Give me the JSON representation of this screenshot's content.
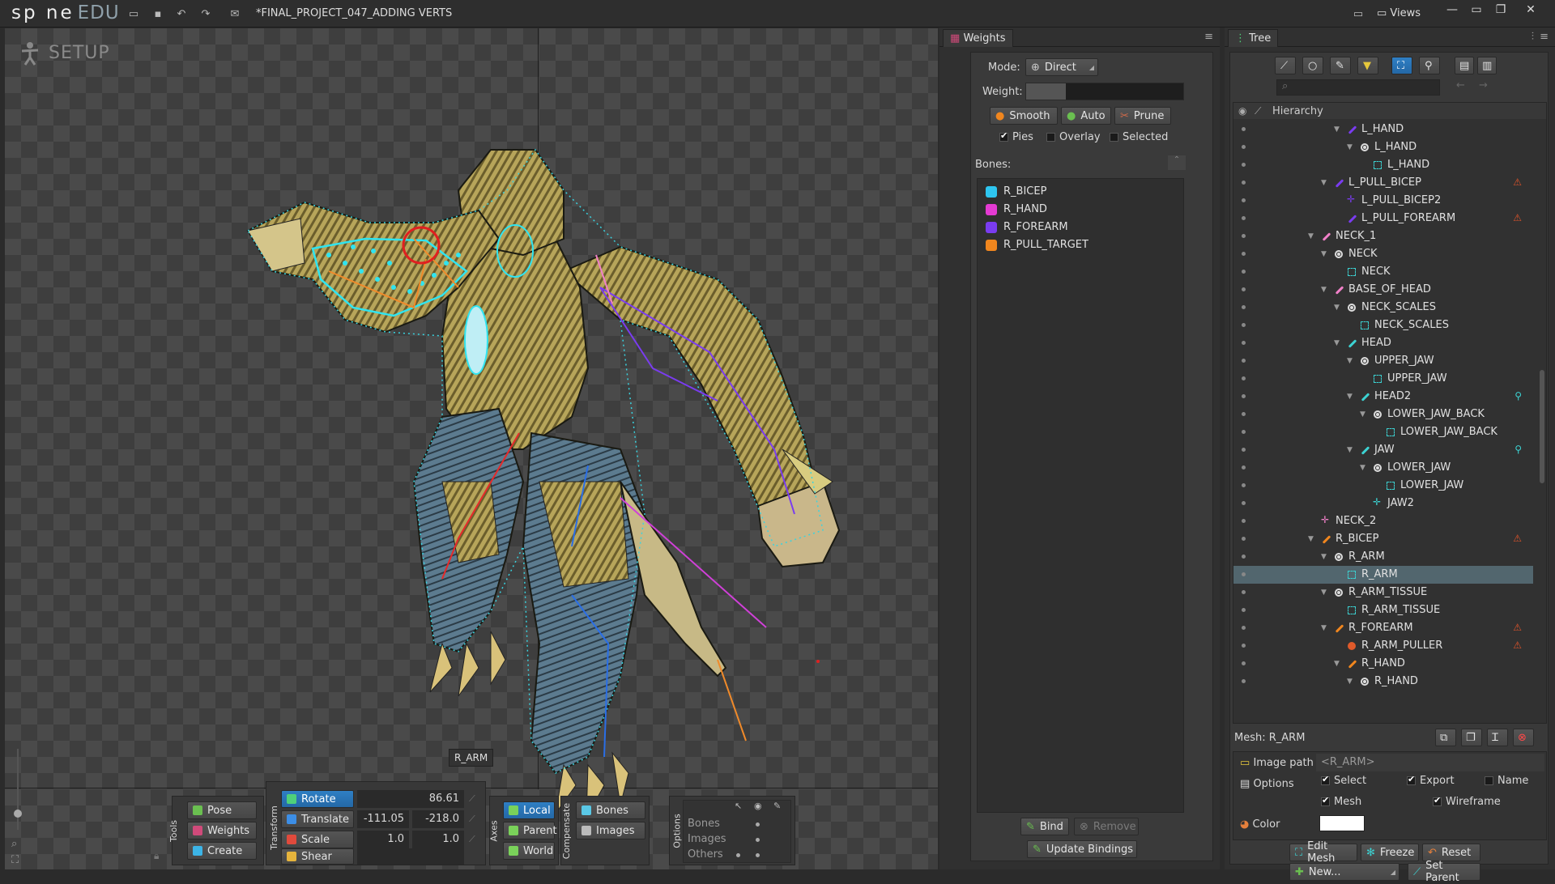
{
  "app": {
    "logo": "sp ne",
    "logo_edu": "EDU",
    "title": "*FINAL_PROJECT_047_ADDING VERTS",
    "views": "Views"
  },
  "viewport": {
    "mode_label": "SETUP",
    "selected_tooltip": "R_ARM"
  },
  "tools": {
    "heading": "Tools",
    "pose": "Pose",
    "weights": "Weights",
    "create": "Create"
  },
  "transform": {
    "heading": "Transform",
    "rotate": "Rotate",
    "rotate_value": "86.61",
    "translate": "Translate",
    "translate_x": "-111.05",
    "translate_y": "-218.0",
    "scale": "Scale",
    "scale_x": "1.0",
    "scale_y": "1.0",
    "shear": "Shear"
  },
  "axes": {
    "heading": "Axes",
    "local": "Local",
    "parent": "Parent",
    "world": "World"
  },
  "compensate": {
    "heading": "Compensate",
    "bones": "Bones",
    "images": "Images"
  },
  "options": {
    "heading": "Options",
    "bones": "Bones",
    "images": "Images",
    "others": "Others"
  },
  "weights_panel": {
    "tab": "Weights",
    "mode_label": "Mode:",
    "mode_value": "Direct",
    "weight_label": "Weight:",
    "weight_fraction": 0.25,
    "smooth": "Smooth",
    "auto": "Auto",
    "prune": "Prune",
    "pies": "Pies",
    "overlay": "Overlay",
    "selected": "Selected",
    "bones_label": "Bones:",
    "bones": [
      {
        "name": "R_BICEP",
        "color": "#2ec6f0"
      },
      {
        "name": "R_HAND",
        "color": "#e43ad2"
      },
      {
        "name": "R_FOREARM",
        "color": "#7a3cf0"
      },
      {
        "name": "R_PULL_TARGET",
        "color": "#f0861e"
      }
    ],
    "bind": "Bind",
    "remove": "Remove",
    "update_bindings": "Update Bindings"
  },
  "tree": {
    "tab": "Tree",
    "hierarchy": "Hierarchy",
    "rows": [
      {
        "label": "L_HAND",
        "icon": "bone",
        "color": "#7a3cf0",
        "indent": 9,
        "arrow": true
      },
      {
        "label": "L_HAND",
        "icon": "slot",
        "indent": 10,
        "arrow": true
      },
      {
        "label": "L_HAND",
        "icon": "mesh",
        "indent": 11
      },
      {
        "label": "L_PULL_BICEP",
        "icon": "bone",
        "color": "#7a3cf0",
        "indent": 8,
        "arrow": true,
        "warn": true
      },
      {
        "label": "L_PULL_BICEP2",
        "icon": "ptn",
        "color": "#7a3cf0",
        "indent": 9
      },
      {
        "label": "L_PULL_FOREARM",
        "icon": "bone",
        "color": "#7a3cf0",
        "indent": 9,
        "warn": true
      },
      {
        "label": "NECK_1",
        "icon": "bone",
        "color": "#f080c8",
        "indent": 7,
        "arrow": true
      },
      {
        "label": "NECK",
        "icon": "slot",
        "indent": 8,
        "arrow": true
      },
      {
        "label": "NECK",
        "icon": "mesh",
        "indent": 9
      },
      {
        "label": "BASE_OF_HEAD",
        "icon": "bone",
        "color": "#f080c8",
        "indent": 8,
        "arrow": true
      },
      {
        "label": "NECK_SCALES",
        "icon": "slot",
        "indent": 9,
        "arrow": true
      },
      {
        "label": "NECK_SCALES",
        "icon": "mesh",
        "indent": 10
      },
      {
        "label": "HEAD",
        "icon": "bone",
        "color": "#3cd2d2",
        "indent": 9,
        "arrow": true
      },
      {
        "label": "UPPER_JAW",
        "icon": "slot",
        "indent": 10,
        "arrow": true
      },
      {
        "label": "UPPER_JAW",
        "icon": "mesh",
        "indent": 11
      },
      {
        "label": "HEAD2",
        "icon": "bone",
        "color": "#3cd2d2",
        "indent": 10,
        "arrow": true,
        "flag": true
      },
      {
        "label": "LOWER_JAW_BACK",
        "icon": "slot",
        "indent": 11,
        "arrow": true
      },
      {
        "label": "LOWER_JAW_BACK",
        "icon": "mesh",
        "indent": 12
      },
      {
        "label": "JAW",
        "icon": "bone",
        "color": "#3cd2d2",
        "indent": 10,
        "arrow": true,
        "flag": true
      },
      {
        "label": "LOWER_JAW",
        "icon": "slot",
        "indent": 11,
        "arrow": true
      },
      {
        "label": "LOWER_JAW",
        "icon": "mesh",
        "indent": 12
      },
      {
        "label": "JAW2",
        "icon": "ptn",
        "color": "#3cd2d2",
        "indent": 11
      },
      {
        "label": "NECK_2",
        "icon": "ptn",
        "color": "#f080c8",
        "indent": 7
      },
      {
        "label": "R_BICEP",
        "icon": "bone",
        "color": "#f0861e",
        "indent": 7,
        "arrow": true,
        "warn": true
      },
      {
        "label": "R_ARM",
        "icon": "slot",
        "indent": 8,
        "arrow": true
      },
      {
        "label": "R_ARM",
        "icon": "mesh",
        "indent": 9,
        "highlight": true
      },
      {
        "label": "R_ARM_TISSUE",
        "icon": "slot",
        "indent": 8,
        "arrow": true
      },
      {
        "label": "R_ARM_TISSUE",
        "icon": "mesh",
        "indent": 9
      },
      {
        "label": "R_FOREARM",
        "icon": "bone",
        "color": "#f0861e",
        "indent": 8,
        "arrow": true,
        "warn": true
      },
      {
        "label": "R_ARM_PULLER",
        "icon": "red",
        "indent": 9,
        "warn": true
      },
      {
        "label": "R_HAND",
        "icon": "bone",
        "color": "#f0861e",
        "indent": 9,
        "arrow": true
      },
      {
        "label": "R_HAND",
        "icon": "slot",
        "indent": 10,
        "arrow": true
      }
    ]
  },
  "mesh_panel": {
    "title": "Mesh: R_ARM",
    "image_path_label": "Image path",
    "image_path_value": "<R_ARM>",
    "options_label": "Options",
    "select": "Select",
    "export": "Export",
    "name": "Name",
    "mesh": "Mesh",
    "wireframe": "Wireframe",
    "color_label": "Color",
    "color_value": "#ffffff",
    "edit_mesh": "Edit Mesh",
    "freeze": "Freeze",
    "reset": "Reset",
    "new": "New...",
    "set_parent": "Set Parent"
  }
}
